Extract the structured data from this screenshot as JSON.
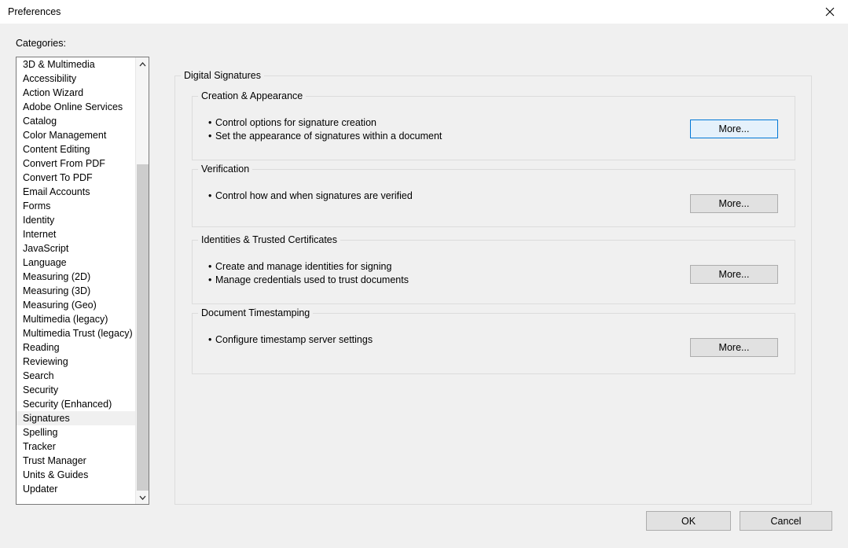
{
  "window": {
    "title": "Preferences",
    "close_icon": "close-icon"
  },
  "sidebar": {
    "label": "Categories:",
    "selected": "Signatures",
    "scroll_up_icon": "chevron-up-icon",
    "scroll_down_icon": "chevron-down-icon",
    "items": [
      {
        "label": "3D & Multimedia"
      },
      {
        "label": "Accessibility"
      },
      {
        "label": "Action Wizard"
      },
      {
        "label": "Adobe Online Services"
      },
      {
        "label": "Catalog"
      },
      {
        "label": "Color Management"
      },
      {
        "label": "Content Editing"
      },
      {
        "label": "Convert From PDF"
      },
      {
        "label": "Convert To PDF"
      },
      {
        "label": "Email Accounts"
      },
      {
        "label": "Forms"
      },
      {
        "label": "Identity"
      },
      {
        "label": "Internet"
      },
      {
        "label": "JavaScript"
      },
      {
        "label": "Language"
      },
      {
        "label": "Measuring (2D)"
      },
      {
        "label": "Measuring (3D)"
      },
      {
        "label": "Measuring (Geo)"
      },
      {
        "label": "Multimedia (legacy)"
      },
      {
        "label": "Multimedia Trust (legacy)"
      },
      {
        "label": "Reading"
      },
      {
        "label": "Reviewing"
      },
      {
        "label": "Search"
      },
      {
        "label": "Security"
      },
      {
        "label": "Security (Enhanced)"
      },
      {
        "label": "Signatures"
      },
      {
        "label": "Spelling"
      },
      {
        "label": "Tracker"
      },
      {
        "label": "Trust Manager"
      },
      {
        "label": "Units & Guides"
      },
      {
        "label": "Updater"
      }
    ]
  },
  "main": {
    "outer_group_title": "Digital Signatures",
    "groups": [
      {
        "title": "Creation & Appearance",
        "bullets": [
          "Control options for signature creation",
          "Set the appearance of signatures within a document"
        ],
        "button_label": "More..."
      },
      {
        "title": "Verification",
        "bullets": [
          "Control how and when signatures are verified"
        ],
        "button_label": "More..."
      },
      {
        "title": "Identities & Trusted Certificates",
        "bullets": [
          "Create and manage identities for signing",
          "Manage credentials used to trust documents"
        ],
        "button_label": "More..."
      },
      {
        "title": "Document Timestamping",
        "bullets": [
          "Configure timestamp server settings"
        ],
        "button_label": "More..."
      }
    ]
  },
  "footer": {
    "ok_label": "OK",
    "cancel_label": "Cancel"
  },
  "colors": {
    "dialog_background": "#f0f0f0",
    "titlebar_background": "#ffffff",
    "focus_border": "#0078d7",
    "focus_fill": "#e5f1fb",
    "button_face": "#e1e1e1",
    "button_border": "#adadad",
    "groupbox_border": "#dcdcdc",
    "selection_highlight": "#f0f0f0",
    "scrollbar_thumb": "#cdcdcd"
  }
}
